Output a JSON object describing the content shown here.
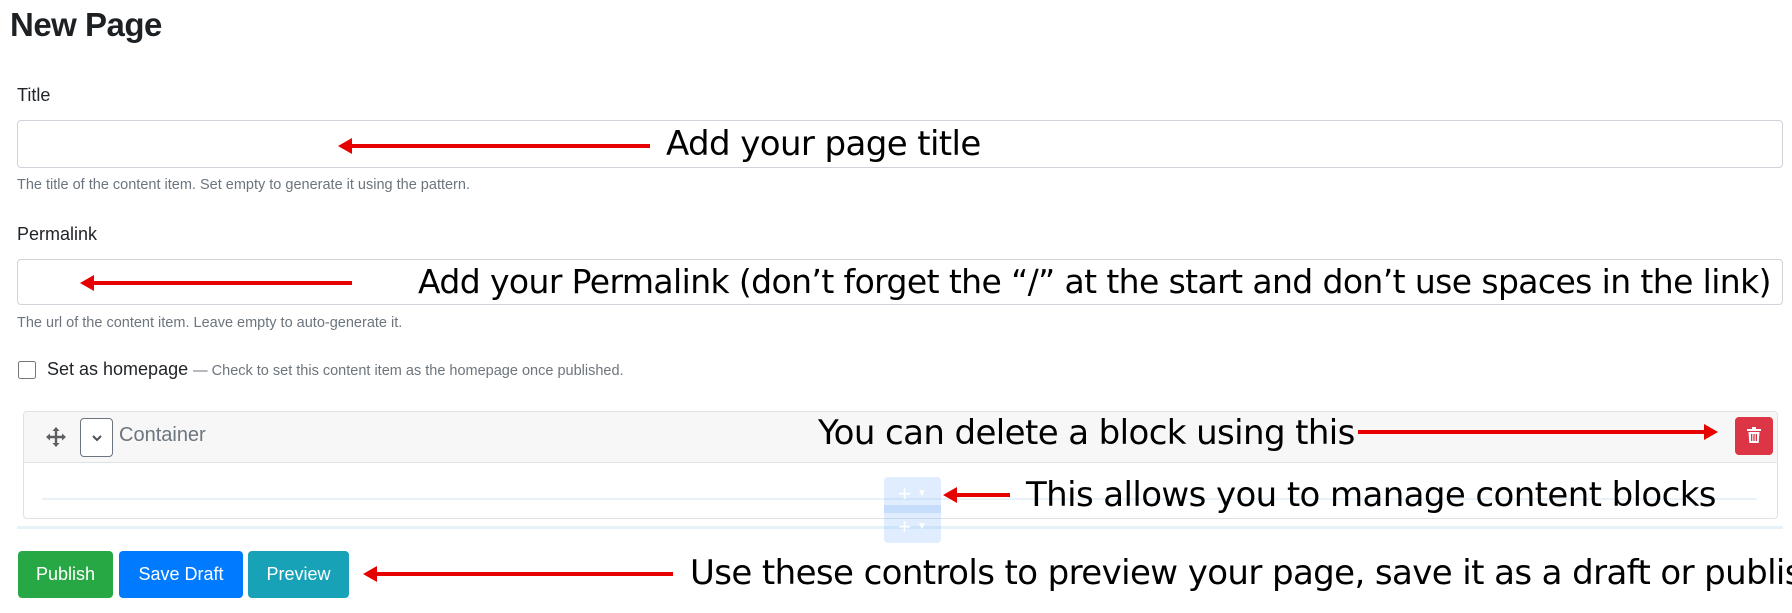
{
  "page": {
    "title": "New Page"
  },
  "form": {
    "title_field": {
      "label": "Title",
      "value": "",
      "help": "The title of the content item. Set empty to generate it using the pattern."
    },
    "permalink_field": {
      "label": "Permalink",
      "value": "",
      "help": "The url of the content item. Leave empty to auto-generate it."
    },
    "homepage_checkbox": {
      "label": "Set as homepage",
      "help": "— Check to set this content item as the homepage once published.",
      "checked": false
    }
  },
  "block": {
    "label": "Container",
    "move_icon": "arrows-move-icon",
    "toggle_icon": "chevron-down-icon",
    "delete_icon": "trash-icon",
    "add_icon": "plus-icon",
    "add_caret_icon": "caret-down-icon"
  },
  "actions": {
    "publish": "Publish",
    "save_draft": "Save Draft",
    "preview": "Preview"
  },
  "colors": {
    "publish": "#28a745",
    "save_draft": "#007bff",
    "preview": "#17a2b8",
    "delete": "#dc3545",
    "annotation_arrow": "#e60000"
  },
  "annotations": {
    "title": "Add your page title",
    "permalink": "Add your Permalink (don’t forget the “/” at the start and don’t use spaces in the link)",
    "delete": "You can delete a block using this",
    "manage": "This allows you to manage content blocks",
    "controls": "Use these controls to preview your page, save it as a draft or publish"
  }
}
